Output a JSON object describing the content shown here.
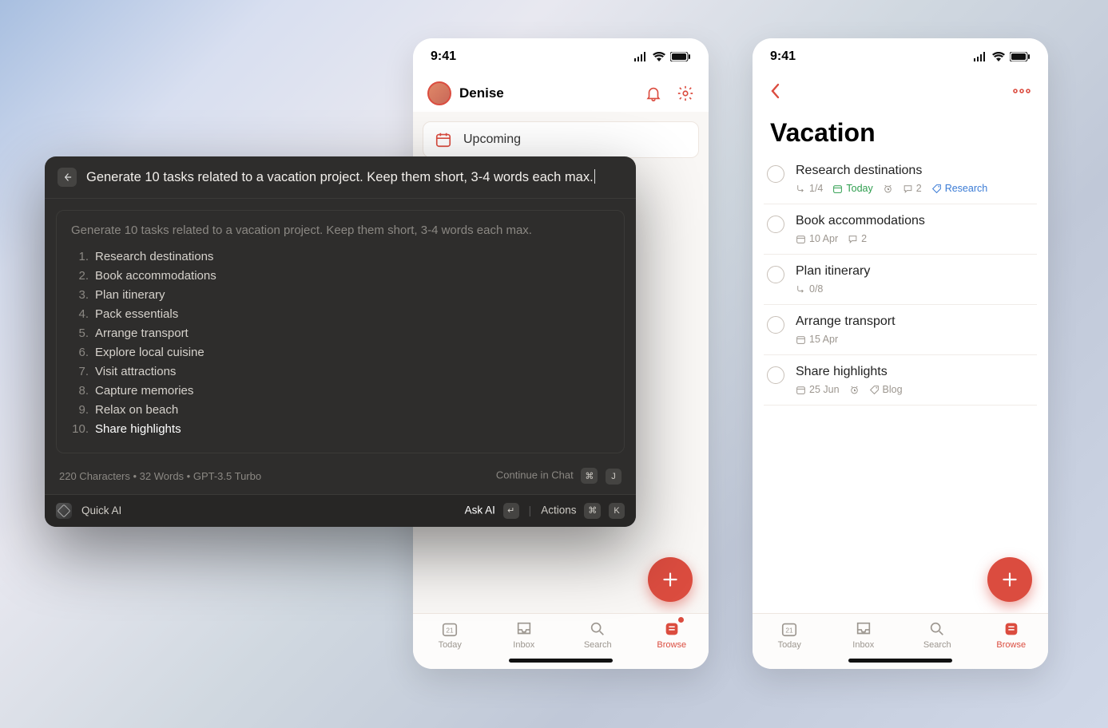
{
  "statusbar_time": "9:41",
  "phone1": {
    "user": "Denise",
    "upcoming_label": "Upcoming"
  },
  "tabs": {
    "today": "Today",
    "inbox": "Inbox",
    "search": "Search",
    "browse": "Browse"
  },
  "phone2": {
    "title": "Vacation",
    "tasks": [
      {
        "title": "Research destinations",
        "subtask": "1/4",
        "date": "Today",
        "date_class": "green",
        "alarm": true,
        "comments": "2",
        "tag": "Research"
      },
      {
        "title": "Book accommodations",
        "date": "10 Apr",
        "comments": "2"
      },
      {
        "title": "Plan itinerary",
        "subtask": "0/8"
      },
      {
        "title": "Arrange transport",
        "date": "15 Apr"
      },
      {
        "title": "Share highlights",
        "date": "25 Jun",
        "alarm": true,
        "tag_plain": "Blog"
      }
    ]
  },
  "palette": {
    "input": "Generate 10 tasks related to a vacation project. Keep them short, 3-4 words each max.",
    "echo": "Generate 10 tasks related to a vacation project. Keep them short, 3-4 words each max.",
    "items": [
      "Research destinations",
      "Book accommodations",
      "Plan itinerary",
      "Pack essentials",
      "Arrange transport",
      "Explore local cuisine",
      "Visit attractions",
      "Capture memories",
      "Relax on beach",
      "Share highlights"
    ],
    "meta": "220 Characters • 32 Words • GPT-3.5 Turbo",
    "continue": "Continue in Chat",
    "footer_left": "Quick AI",
    "ask": "Ask AI",
    "actions": "Actions",
    "key1": "⌘",
    "key2": "J",
    "key3": "↵",
    "key4": "⌘",
    "key5": "K"
  }
}
